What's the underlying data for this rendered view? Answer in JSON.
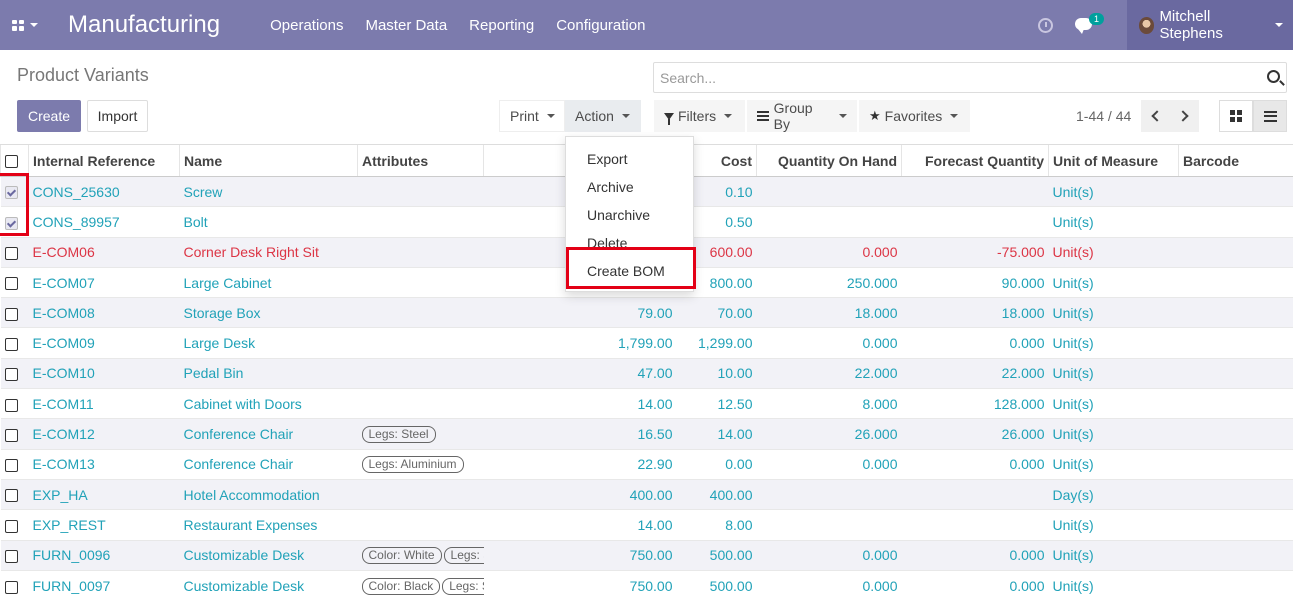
{
  "navbar": {
    "app_name": "Manufacturing",
    "menus": [
      "Operations",
      "Master Data",
      "Reporting",
      "Configuration"
    ],
    "chat_badge": "1",
    "user_name": "Mitchell Stephens",
    "bg_color": "#7c7bad"
  },
  "control_panel": {
    "title": "Product Variants",
    "search_placeholder": "Search...",
    "create_label": "Create",
    "import_label": "Import",
    "print_label": "Print",
    "action_label": "Action",
    "filters_label": "Filters",
    "groupby_label": "Group By",
    "favorites_label": "Favorites",
    "pager": "1-44 / 44"
  },
  "action_menu": [
    "Export",
    "Archive",
    "Unarchive",
    "Delete",
    "Create BOM"
  ],
  "columns": {
    "internal_ref": "Internal Reference",
    "name": "Name",
    "attributes": "Attributes",
    "sales_price": "",
    "cost": "Cost",
    "qty_on_hand": "Quantity On Hand",
    "forecast_qty": "Forecast Quantity",
    "uom": "Unit of Measure",
    "barcode": "Barcode"
  },
  "rows": [
    {
      "ref": "CONS_25630",
      "name": "Screw",
      "attrs": [],
      "price": "",
      "cost": "0.10",
      "qty": "",
      "forecast": "",
      "uom": "Unit(s)",
      "checked": true,
      "danger": false
    },
    {
      "ref": "CONS_89957",
      "name": "Bolt",
      "attrs": [],
      "price": "",
      "cost": "0.50",
      "qty": "",
      "forecast": "",
      "uom": "Unit(s)",
      "checked": true,
      "danger": false
    },
    {
      "ref": "E-COM06",
      "name": "Corner Desk Right Sit",
      "attrs": [],
      "price": "",
      "cost": "600.00",
      "qty": "0.000",
      "forecast": "-75.000",
      "uom": "Unit(s)",
      "checked": false,
      "danger": true
    },
    {
      "ref": "E-COM07",
      "name": "Large Cabinet",
      "attrs": [],
      "price": "",
      "cost": "800.00",
      "qty": "250.000",
      "forecast": "90.000",
      "uom": "Unit(s)",
      "checked": false,
      "danger": false
    },
    {
      "ref": "E-COM08",
      "name": "Storage Box",
      "attrs": [],
      "price": "79.00",
      "cost": "70.00",
      "qty": "18.000",
      "forecast": "18.000",
      "uom": "Unit(s)",
      "checked": false,
      "danger": false
    },
    {
      "ref": "E-COM09",
      "name": "Large Desk",
      "attrs": [],
      "price": "1,799.00",
      "cost": "1,299.00",
      "qty": "0.000",
      "forecast": "0.000",
      "uom": "Unit(s)",
      "checked": false,
      "danger": false
    },
    {
      "ref": "E-COM10",
      "name": "Pedal Bin",
      "attrs": [],
      "price": "47.00",
      "cost": "10.00",
      "qty": "22.000",
      "forecast": "22.000",
      "uom": "Unit(s)",
      "checked": false,
      "danger": false
    },
    {
      "ref": "E-COM11",
      "name": "Cabinet with Doors",
      "attrs": [],
      "price": "14.00",
      "cost": "12.50",
      "qty": "8.000",
      "forecast": "128.000",
      "uom": "Unit(s)",
      "checked": false,
      "danger": false
    },
    {
      "ref": "E-COM12",
      "name": "Conference Chair",
      "attrs": [
        "Legs: Steel"
      ],
      "price": "16.50",
      "cost": "14.00",
      "qty": "26.000",
      "forecast": "26.000",
      "uom": "Unit(s)",
      "checked": false,
      "danger": false
    },
    {
      "ref": "E-COM13",
      "name": "Conference Chair",
      "attrs": [
        "Legs: Aluminium"
      ],
      "price": "22.90",
      "cost": "0.00",
      "qty": "0.000",
      "forecast": "0.000",
      "uom": "Unit(s)",
      "checked": false,
      "danger": false
    },
    {
      "ref": "EXP_HA",
      "name": "Hotel Accommodation",
      "attrs": [],
      "price": "400.00",
      "cost": "400.00",
      "qty": "",
      "forecast": "",
      "uom": "Day(s)",
      "checked": false,
      "danger": false
    },
    {
      "ref": "EXP_REST",
      "name": "Restaurant Expenses",
      "attrs": [],
      "price": "14.00",
      "cost": "8.00",
      "qty": "",
      "forecast": "",
      "uom": "Unit(s)",
      "checked": false,
      "danger": false
    },
    {
      "ref": "FURN_0096",
      "name": "Customizable Desk",
      "attrs": [
        "Color: White",
        "Legs: Steel"
      ],
      "price": "750.00",
      "cost": "500.00",
      "qty": "0.000",
      "forecast": "0.000",
      "uom": "Unit(s)",
      "checked": false,
      "danger": false
    },
    {
      "ref": "FURN_0097",
      "name": "Customizable Desk",
      "attrs": [
        "Color: Black",
        "Legs: Steel"
      ],
      "price": "750.00",
      "cost": "500.00",
      "qty": "0.000",
      "forecast": "0.000",
      "uom": "Unit(s)",
      "checked": false,
      "danger": false
    }
  ]
}
